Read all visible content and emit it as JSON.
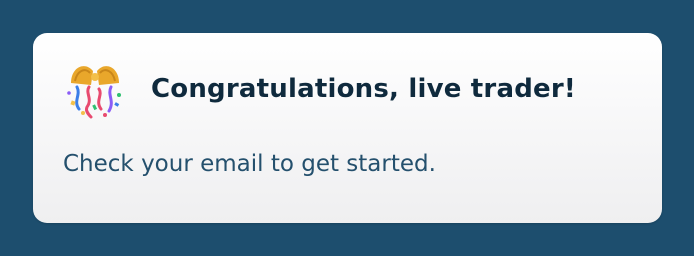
{
  "notification": {
    "icon": "confetti-ball-icon",
    "title": "Congratulations, live trader!",
    "message": "Check your email to get started."
  },
  "colors": {
    "background": "#1d4e6e",
    "card": "#f6f6f7",
    "title_text": "#0f2a3d",
    "message_text": "#24506d"
  }
}
